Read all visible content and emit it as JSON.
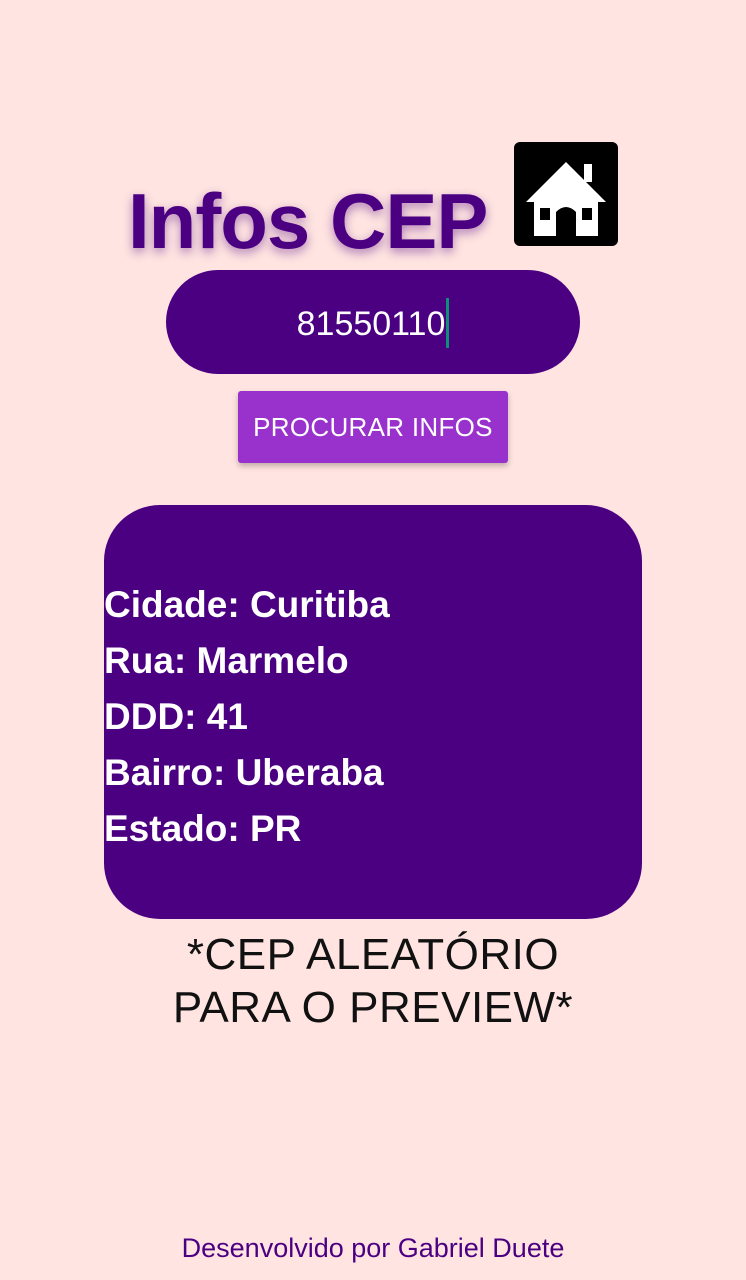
{
  "colors": {
    "background": "#FFE4E1",
    "primary": "#4B0082",
    "button": "#9932CC",
    "caret": "#0F8F7A"
  },
  "header": {
    "title": "Infos CEP",
    "icon": "house-icon"
  },
  "search": {
    "value": "81550110",
    "button_label": "PROCURAR INFOS"
  },
  "result": {
    "lines": [
      "Cidade: Curitiba",
      "Rua: Marmelo",
      "DDD: 41",
      "Bairro: Uberaba",
      "Estado: PR"
    ]
  },
  "note": {
    "line1": "*CEP ALEATÓRIO",
    "line2": "PARA O PREVIEW*"
  },
  "footer": {
    "credit": "Desenvolvido por Gabriel Duete"
  }
}
